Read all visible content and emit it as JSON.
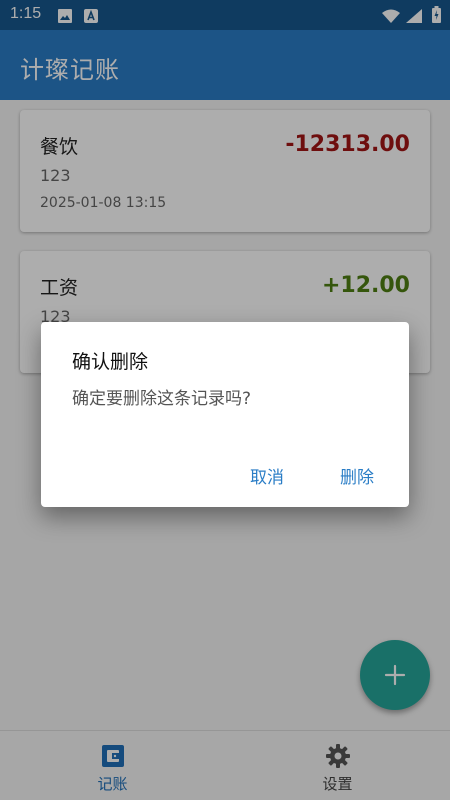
{
  "status_bar": {
    "time": "1:15"
  },
  "app_bar": {
    "title": "计璨记账"
  },
  "records": [
    {
      "category": "餐饮",
      "note": "123",
      "datetime": "2025-01-08 13:15",
      "amount": "-12313.00",
      "amount_color": "#a31515"
    },
    {
      "category": "工资",
      "note": "123",
      "datetime": "",
      "amount": "+12.00",
      "amount_color": "#4e7f12"
    }
  ],
  "fab": {
    "icon": "add-icon"
  },
  "bottom_nav": {
    "items": [
      {
        "label": "记账",
        "icon": "wallet-icon",
        "active": true
      },
      {
        "label": "设置",
        "icon": "gear-icon",
        "active": false
      }
    ]
  },
  "dialog": {
    "title": "确认删除",
    "message": "确定要删除这条记录吗?",
    "cancel_label": "取消",
    "confirm_label": "删除"
  },
  "colors": {
    "primary": "#2a7dc6",
    "status_bar": "#17588e",
    "fab": "#26a69a",
    "expense": "#a31515",
    "income": "#4e7f12"
  }
}
